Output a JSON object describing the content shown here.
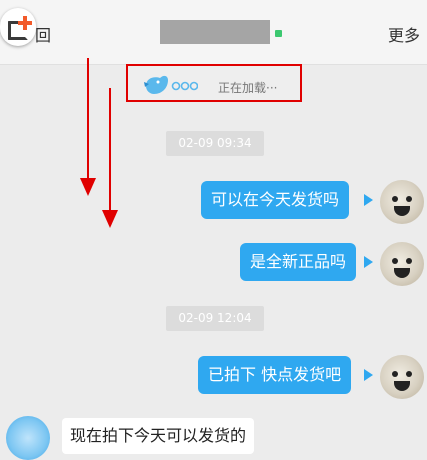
{
  "header": {
    "back_label": "返回",
    "back_visible": "回",
    "more_label": "更多"
  },
  "loading": {
    "text": "正在加载···"
  },
  "messages": [
    {
      "type": "timestamp",
      "text": "02-09 09:34"
    },
    {
      "type": "outgoing",
      "text": "可以在今天发货吗"
    },
    {
      "type": "outgoing",
      "text": "是全新正品吗"
    },
    {
      "type": "timestamp",
      "text": "02-09 12:04"
    },
    {
      "type": "outgoing",
      "text": "已拍下 快点发货吧"
    },
    {
      "type": "incoming",
      "text": "现在拍下今天可以发货的"
    }
  ],
  "colors": {
    "bubble": "#2fa8f0",
    "annotation_red": "#e00000",
    "online": "#3cc870",
    "plus_orange": "#f25a2a"
  },
  "icons": [
    "add-icon",
    "bird-loading-icon",
    "arrow-down-icon"
  ]
}
